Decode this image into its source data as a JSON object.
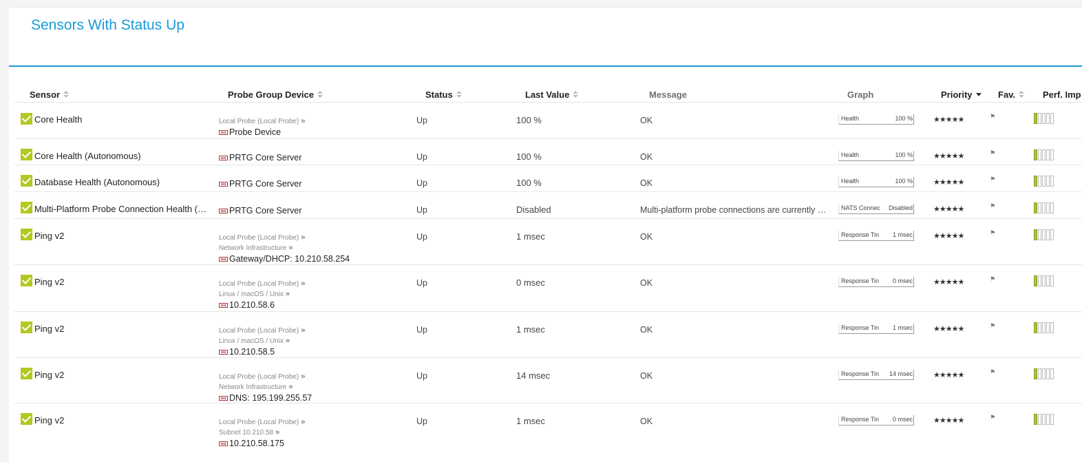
{
  "page": {
    "title": "Sensors With Status Up"
  },
  "columns": {
    "sensor": "Sensor",
    "probe_group_device": "Probe Group Device",
    "status": "Status",
    "last_value": "Last Value",
    "message": "Message",
    "graph": "Graph",
    "priority": "Priority",
    "fav": "Fav.",
    "perf_impact": "Perf. Imp"
  },
  "rows": [
    {
      "sensor": "Core Health",
      "crumbs": [
        "Local Probe (Local Probe)"
      ],
      "device": "Probe Device",
      "status": "Up",
      "last_value": "100 %",
      "message": "OK",
      "graph_label": "Health",
      "graph_value": "100 %",
      "stars": "★★★★★"
    },
    {
      "sensor": "Core Health (Autonomous)",
      "crumbs": [],
      "device": "PRTG Core Server",
      "status": "Up",
      "last_value": "100 %",
      "message": "OK",
      "graph_label": "Health",
      "graph_value": "100 %",
      "stars": "★★★★★"
    },
    {
      "sensor": "Database Health (Autonomous)",
      "crumbs": [],
      "device": "PRTG Core Server",
      "status": "Up",
      "last_value": "100 %",
      "message": "OK",
      "graph_label": "Health",
      "graph_value": "100 %",
      "stars": "★★★★★"
    },
    {
      "sensor": "Multi-Platform Probe Connection Health (…",
      "crumbs": [],
      "device": "PRTG Core Server",
      "status": "Up",
      "last_value": "Disabled",
      "message": "Multi-platform probe connections are currently not…",
      "graph_label": "NATS Connec",
      "graph_value": "Disabled",
      "stars": "★★★★★"
    },
    {
      "sensor": "Ping v2",
      "crumbs": [
        "Local Probe (Local Probe)",
        "Network Infrastructure"
      ],
      "device": "Gateway/DHCP: 10.210.58.254",
      "status": "Up",
      "last_value": "1 msec",
      "message": "OK",
      "graph_label": "Response Tin",
      "graph_value": "1 msec",
      "stars": "★★★★★"
    },
    {
      "sensor": "Ping v2",
      "crumbs": [
        "Local Probe (Local Probe)",
        "Linux / macOS / Unix"
      ],
      "device": "10.210.58.6",
      "status": "Up",
      "last_value": "0 msec",
      "message": "OK",
      "graph_label": "Response Tin",
      "graph_value": "0 msec",
      "stars": "★★★★★"
    },
    {
      "sensor": "Ping v2",
      "crumbs": [
        "Local Probe (Local Probe)",
        "Linux / macOS / Unix"
      ],
      "device": "10.210.58.5",
      "status": "Up",
      "last_value": "1 msec",
      "message": "OK",
      "graph_label": "Response Tin",
      "graph_value": "1 msec",
      "stars": "★★★★★"
    },
    {
      "sensor": "Ping v2",
      "crumbs": [
        "Local Probe (Local Probe)",
        "Network Infrastructure"
      ],
      "device": "DNS: 195.199.255.57",
      "status": "Up",
      "last_value": "14 msec",
      "message": "OK",
      "graph_label": "Response Tin",
      "graph_value": "14 msec",
      "stars": "★★★★★"
    },
    {
      "sensor": "Ping v2",
      "crumbs": [
        "Local Probe (Local Probe)",
        "Subnet 10.210.58"
      ],
      "device": "10.210.58.175",
      "status": "Up",
      "last_value": "1 msec",
      "message": "OK",
      "graph_label": "Response Tin",
      "graph_value": "0 msec",
      "stars": "★★★★★"
    }
  ],
  "icons": {
    "status_check": "check-icon",
    "device": "device-icon",
    "favorite": "flag-icon",
    "sort": "sort-icon"
  },
  "colors": {
    "accent": "#1a9ad6",
    "status_up": "#b4c822",
    "perf_bar": "#a6c23a"
  }
}
